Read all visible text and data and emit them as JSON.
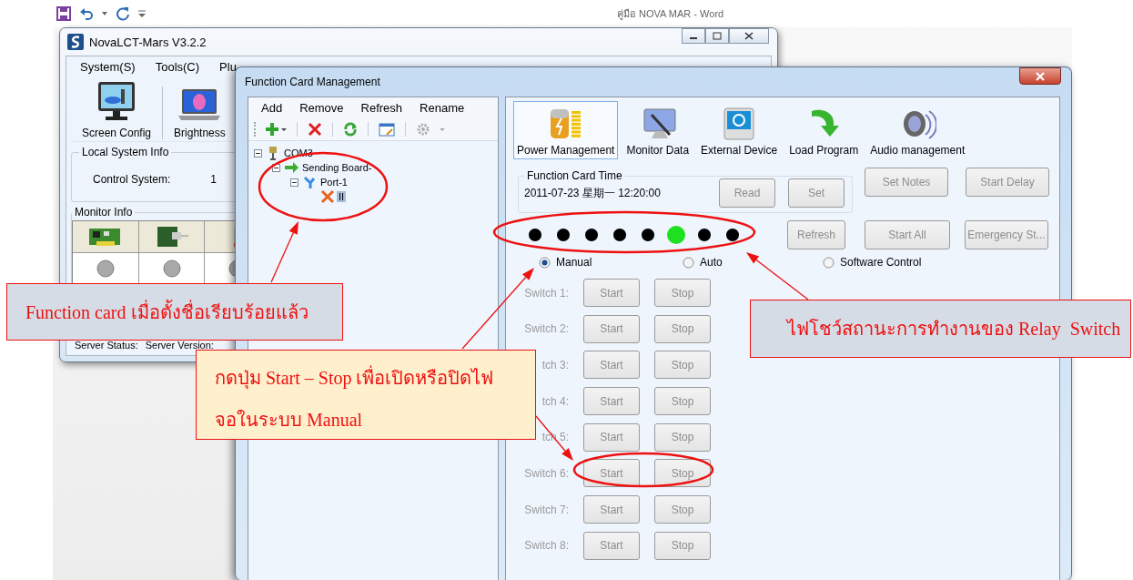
{
  "word": {
    "title": "คู่มือ NOVA MAR - Word"
  },
  "main_window": {
    "title": "NovaLCT-Mars V3.2.2",
    "menu": [
      "System(S)",
      "Tools(C)",
      "Plu"
    ],
    "toolbar": [
      "Screen Config",
      "Brightness"
    ],
    "local_system_info": {
      "title": "Local System Info",
      "label": "Control System:",
      "value": "1"
    },
    "monitor_info": {
      "title": "Monitor Info"
    },
    "status_bar": [
      "Server Status:",
      "Server Version:"
    ]
  },
  "dialog": {
    "title": "Function Card Management",
    "tree_menu": [
      "Add",
      "Remove",
      "Refresh",
      "Rename"
    ],
    "tree": [
      {
        "label": "COM3",
        "expanded": true,
        "selected": false,
        "children": [
          {
            "label": "Sending Board-",
            "expanded": true,
            "selected": false,
            "children": [
              {
                "label": "Port-1",
                "expanded": true,
                "selected": false,
                "children": [
                  {
                    "label": "II",
                    "selected": true
                  }
                ]
              }
            ]
          }
        ]
      }
    ],
    "tools": [
      {
        "label": "Power Management",
        "selected": true
      },
      {
        "label": "Monitor Data",
        "selected": false
      },
      {
        "label": "External Device",
        "selected": false
      },
      {
        "label": "Load Program",
        "selected": false
      },
      {
        "label": "Audio management",
        "selected": false
      }
    ],
    "card_time": {
      "title": "Function Card Time",
      "value": "2011-07-23 星期一 12:20:00",
      "buttons": [
        {
          "label": "Read",
          "disabled": true
        },
        {
          "label": "Set",
          "disabled": true
        }
      ]
    },
    "actions": [
      {
        "label": "Set Notes",
        "disabled": true
      },
      {
        "label": "Start Delay",
        "disabled": true
      },
      {
        "label": "Refresh",
        "disabled": true
      },
      {
        "label": "Start All",
        "disabled": true
      },
      {
        "label": "Emergency St...",
        "disabled": true
      }
    ],
    "relays": [
      {
        "on": false
      },
      {
        "on": false
      },
      {
        "on": false
      },
      {
        "on": false
      },
      {
        "on": false
      },
      {
        "on": true
      },
      {
        "on": false
      },
      {
        "on": false
      }
    ],
    "modes": [
      {
        "label": "Manual",
        "selected": true
      },
      {
        "label": "Auto",
        "selected": false
      },
      {
        "label": "Software Control",
        "selected": false
      }
    ],
    "switches": [
      {
        "label": "Switch 1:",
        "disabled": true,
        "buttons": [
          "Start",
          "Stop"
        ]
      },
      {
        "label": "Switch 2:",
        "disabled": true,
        "buttons": [
          "Start",
          "Stop"
        ]
      },
      {
        "label": "tch 3:",
        "disabled": true,
        "buttons": [
          "Start",
          "Stop"
        ]
      },
      {
        "label": "tch 4:",
        "disabled": true,
        "buttons": [
          "Start",
          "Stop"
        ]
      },
      {
        "label": "tch 5:",
        "disabled": true,
        "buttons": [
          "Start",
          "Stop"
        ]
      },
      {
        "label": "Switch 6:",
        "disabled": true,
        "buttons": [
          "Start",
          "Stop"
        ]
      },
      {
        "label": "Switch 7:",
        "disabled": true,
        "buttons": [
          "Start",
          "Stop"
        ]
      },
      {
        "label": "Switch 8:",
        "disabled": true,
        "buttons": [
          "Start",
          "Stop"
        ]
      }
    ]
  },
  "callouts": [
    {
      "kind": "note",
      "lines": [
        "Function card เมื่อตั้งชื่อเรียบร้อยแล้ว"
      ]
    },
    {
      "kind": "tip",
      "lines": [
        "กดปุ่ม Start – Stop เพื่อเปิดหรือปิดไฟ",
        "จอในระบบ Manual"
      ]
    },
    {
      "kind": "note",
      "lines": [
        "ไฟโชว์สถานะการทำงานของ Relay  Switch"
      ]
    }
  ]
}
